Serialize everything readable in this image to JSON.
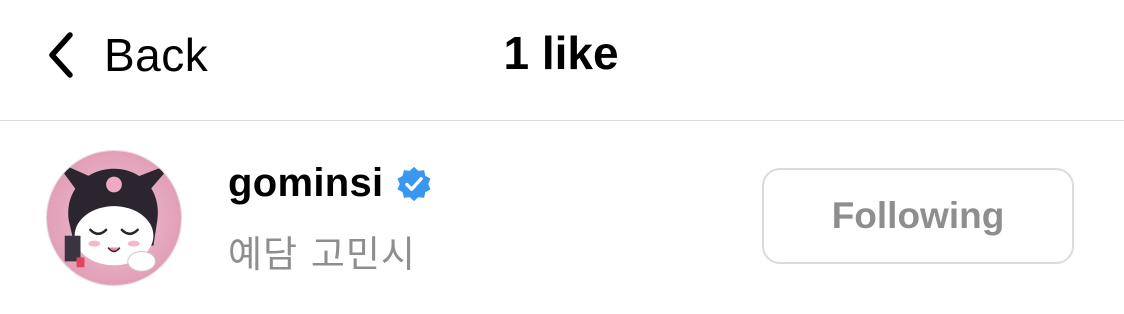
{
  "header": {
    "back_label": "Back",
    "title": "1 like"
  },
  "likes": [
    {
      "username": "gominsi",
      "full_name": "예담 고민시",
      "verified": true,
      "follow_button_label": "Following"
    }
  ],
  "colors": {
    "verified_badge": "#3897f0",
    "secondary_text": "#8e8e8e",
    "divider": "#d9d9d9",
    "button_border": "#dbdbdb"
  },
  "icons": {
    "back": "chevron-left-icon",
    "verified": "verified-badge-icon"
  }
}
